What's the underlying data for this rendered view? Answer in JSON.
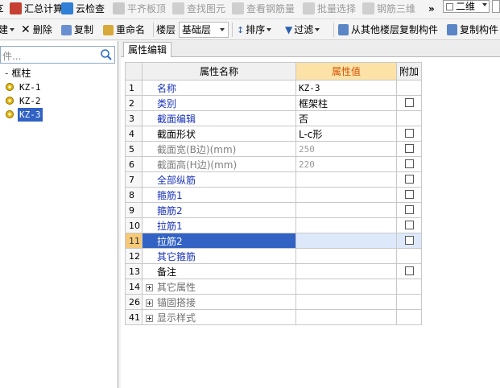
{
  "toolbar1": {
    "items": [
      {
        "label": "汇总计算",
        "enabled": true
      },
      {
        "label": "云检查",
        "enabled": true
      },
      {
        "label": "平齐板顶",
        "enabled": false
      },
      {
        "label": "查找图元",
        "enabled": false
      },
      {
        "label": "查看钢筋量",
        "enabled": false
      },
      {
        "label": "批量选择",
        "enabled": false
      },
      {
        "label": "钢筋三维",
        "enabled": false
      }
    ],
    "overflow": "»",
    "view_select": "二维"
  },
  "toolbar2": {
    "new_label": "建",
    "delete_label": "删除",
    "copy_label": "复制",
    "rename_label": "重命名",
    "floor_label": "楼层",
    "floor_value": "基础层",
    "sort_label": "排序",
    "filter_label": "过滤",
    "copy_from_floor_label": "从其他楼层复制构件",
    "copy_component_label": "复制构件"
  },
  "left_panel": {
    "search_placeholder": "件...",
    "tree": {
      "root_label": "框柱",
      "children": [
        "KZ-1",
        "KZ-2",
        "KZ-3"
      ],
      "selected": "KZ-3"
    }
  },
  "right_panel": {
    "tab_label": "属性编辑",
    "columns": {
      "name": "属性名称",
      "value": "属性值",
      "extra": "附加"
    },
    "rows": [
      {
        "num": "1",
        "name": "名称",
        "value": "KZ-3",
        "style": "blue",
        "checkbox": false
      },
      {
        "num": "2",
        "name": "类别",
        "value": "框架柱",
        "style": "blue",
        "checkbox": true
      },
      {
        "num": "3",
        "name": "截面编辑",
        "value": "否",
        "style": "blue",
        "checkbox": false
      },
      {
        "num": "4",
        "name": "截面形状",
        "value": "L-c形",
        "style": "black",
        "checkbox": true
      },
      {
        "num": "5",
        "name": "截面宽(B边)(mm)",
        "value": "250",
        "style": "gray",
        "checkbox": true
      },
      {
        "num": "6",
        "name": "截面高(H边)(mm)",
        "value": "220",
        "style": "gray",
        "checkbox": true
      },
      {
        "num": "7",
        "name": "全部纵筋",
        "value": "",
        "style": "blue",
        "checkbox": true
      },
      {
        "num": "8",
        "name": "箍筋1",
        "value": "",
        "style": "blue",
        "checkbox": true
      },
      {
        "num": "9",
        "name": "箍筋2",
        "value": "",
        "style": "blue",
        "checkbox": true
      },
      {
        "num": "10",
        "name": "拉筋1",
        "value": "",
        "style": "blue",
        "checkbox": true
      },
      {
        "num": "11",
        "name": "拉筋2",
        "value": "",
        "style": "blue",
        "checkbox": true,
        "selected": true
      },
      {
        "num": "12",
        "name": "其它箍筋",
        "value": "",
        "style": "blue",
        "checkbox": false
      },
      {
        "num": "13",
        "name": "备注",
        "value": "",
        "style": "black",
        "checkbox": true
      }
    ],
    "groups": [
      {
        "num": "14",
        "name": "其它属性"
      },
      {
        "num": "26",
        "name": "锚固搭接"
      },
      {
        "num": "41",
        "name": "显示样式"
      }
    ]
  }
}
